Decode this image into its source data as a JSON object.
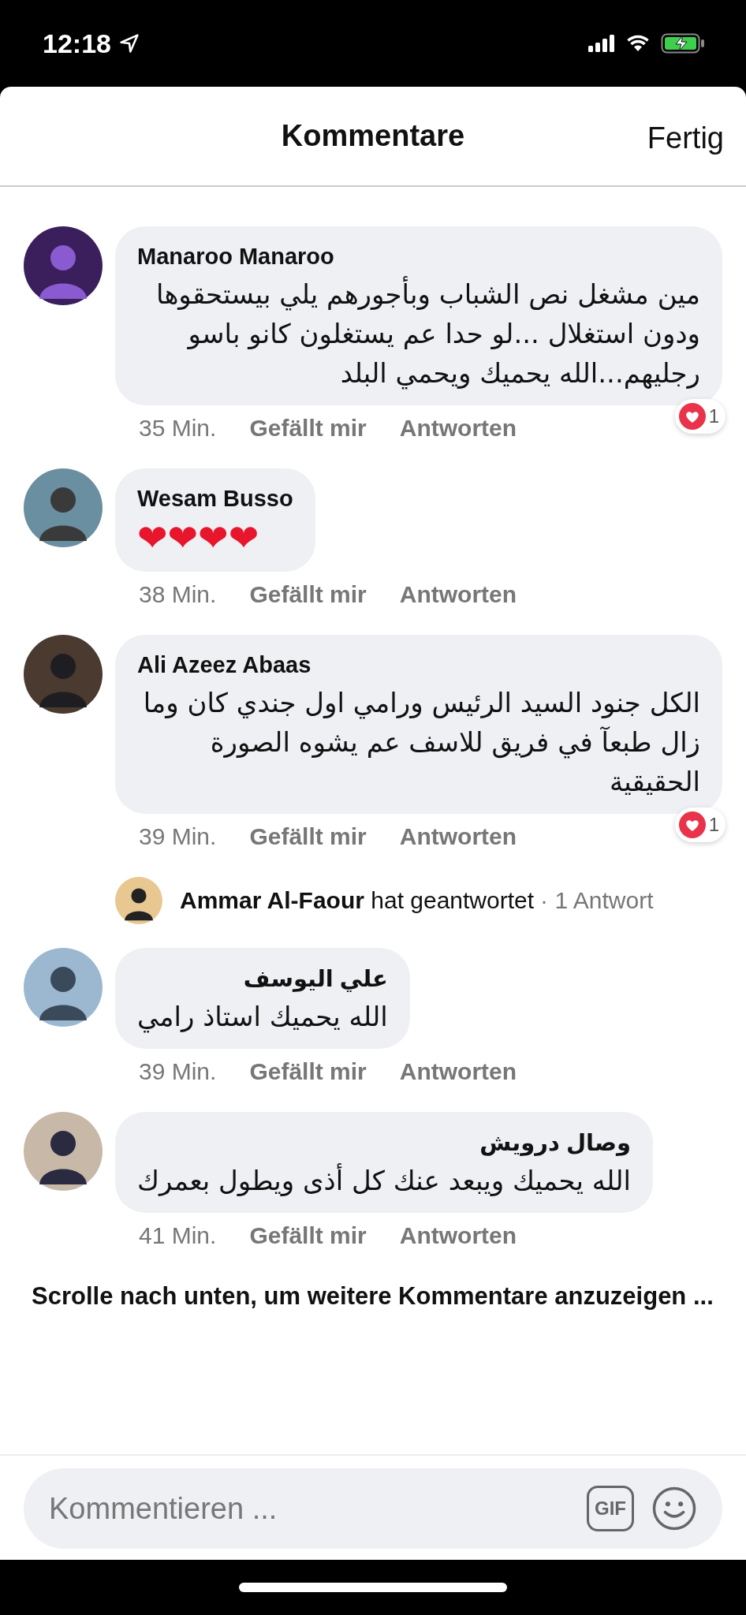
{
  "status_bar": {
    "time": "12:18"
  },
  "header": {
    "title": "Kommentare",
    "done": "Fertig"
  },
  "comments": [
    {
      "kind": "comment",
      "author": "Manaroo Manaroo",
      "text": "مين مشغل نص الشباب وبأجورهم يلي بيستحقوها ودون استغلال ...لو حدا عم يستغلون كانو باسو رجليهم...الله يحميك ويحمي البلد",
      "time": "35 Min.",
      "like": "Gefällt mir",
      "reply": "Antworten",
      "reactions": "1"
    },
    {
      "kind": "comment",
      "author": "Wesam Busso",
      "text": "❤❤❤❤",
      "time": "38 Min.",
      "like": "Gefällt mir",
      "reply": "Antworten"
    },
    {
      "kind": "comment",
      "author": "Ali Azeez Abaas",
      "text": "الكل جنود السيد الرئيس ورامي اول جندي كان وما زال طبعآ في فريق للاسف عم يشوه الصورة الحقيقية",
      "time": "39 Min.",
      "like": "Gefällt mir",
      "reply": "Antworten",
      "reactions": "1"
    },
    {
      "kind": "replies",
      "text": "**Ammar Al-Faour** hat geantwortet",
      "count": "· 1 Antwort"
    },
    {
      "kind": "comment",
      "author": "علي اليوسف",
      "text": "الله يحميك استاذ رامي",
      "time": "39 Min.",
      "like": "Gefällt mir",
      "reply": "Antworten"
    },
    {
      "kind": "comment",
      "author": "وصال درويش",
      "text": "الله يحميك ويبعد عنك كل أذى ويطول بعمرك",
      "time": "41 Min.",
      "like": "Gefällt mir",
      "reply": "Antworten"
    }
  ],
  "more": "Scrolle nach unten, um weitere Kommentare anzuzeigen ...",
  "composer": {
    "placeholder": "Kommentieren ...",
    "gif": "GIF"
  }
}
